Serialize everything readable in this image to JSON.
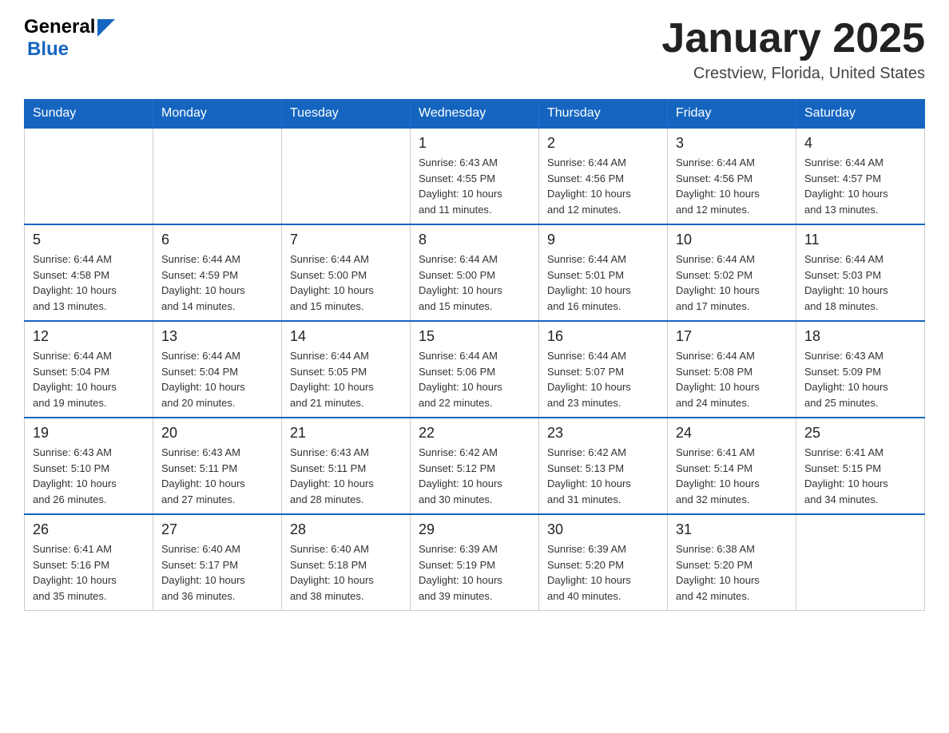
{
  "header": {
    "logo_general": "General",
    "logo_blue": "Blue",
    "month_title": "January 2025",
    "location": "Crestview, Florida, United States"
  },
  "days_of_week": [
    "Sunday",
    "Monday",
    "Tuesday",
    "Wednesday",
    "Thursday",
    "Friday",
    "Saturday"
  ],
  "weeks": [
    [
      {
        "day": "",
        "info": ""
      },
      {
        "day": "",
        "info": ""
      },
      {
        "day": "",
        "info": ""
      },
      {
        "day": "1",
        "info": "Sunrise: 6:43 AM\nSunset: 4:55 PM\nDaylight: 10 hours\nand 11 minutes."
      },
      {
        "day": "2",
        "info": "Sunrise: 6:44 AM\nSunset: 4:56 PM\nDaylight: 10 hours\nand 12 minutes."
      },
      {
        "day": "3",
        "info": "Sunrise: 6:44 AM\nSunset: 4:56 PM\nDaylight: 10 hours\nand 12 minutes."
      },
      {
        "day": "4",
        "info": "Sunrise: 6:44 AM\nSunset: 4:57 PM\nDaylight: 10 hours\nand 13 minutes."
      }
    ],
    [
      {
        "day": "5",
        "info": "Sunrise: 6:44 AM\nSunset: 4:58 PM\nDaylight: 10 hours\nand 13 minutes."
      },
      {
        "day": "6",
        "info": "Sunrise: 6:44 AM\nSunset: 4:59 PM\nDaylight: 10 hours\nand 14 minutes."
      },
      {
        "day": "7",
        "info": "Sunrise: 6:44 AM\nSunset: 5:00 PM\nDaylight: 10 hours\nand 15 minutes."
      },
      {
        "day": "8",
        "info": "Sunrise: 6:44 AM\nSunset: 5:00 PM\nDaylight: 10 hours\nand 15 minutes."
      },
      {
        "day": "9",
        "info": "Sunrise: 6:44 AM\nSunset: 5:01 PM\nDaylight: 10 hours\nand 16 minutes."
      },
      {
        "day": "10",
        "info": "Sunrise: 6:44 AM\nSunset: 5:02 PM\nDaylight: 10 hours\nand 17 minutes."
      },
      {
        "day": "11",
        "info": "Sunrise: 6:44 AM\nSunset: 5:03 PM\nDaylight: 10 hours\nand 18 minutes."
      }
    ],
    [
      {
        "day": "12",
        "info": "Sunrise: 6:44 AM\nSunset: 5:04 PM\nDaylight: 10 hours\nand 19 minutes."
      },
      {
        "day": "13",
        "info": "Sunrise: 6:44 AM\nSunset: 5:04 PM\nDaylight: 10 hours\nand 20 minutes."
      },
      {
        "day": "14",
        "info": "Sunrise: 6:44 AM\nSunset: 5:05 PM\nDaylight: 10 hours\nand 21 minutes."
      },
      {
        "day": "15",
        "info": "Sunrise: 6:44 AM\nSunset: 5:06 PM\nDaylight: 10 hours\nand 22 minutes."
      },
      {
        "day": "16",
        "info": "Sunrise: 6:44 AM\nSunset: 5:07 PM\nDaylight: 10 hours\nand 23 minutes."
      },
      {
        "day": "17",
        "info": "Sunrise: 6:44 AM\nSunset: 5:08 PM\nDaylight: 10 hours\nand 24 minutes."
      },
      {
        "day": "18",
        "info": "Sunrise: 6:43 AM\nSunset: 5:09 PM\nDaylight: 10 hours\nand 25 minutes."
      }
    ],
    [
      {
        "day": "19",
        "info": "Sunrise: 6:43 AM\nSunset: 5:10 PM\nDaylight: 10 hours\nand 26 minutes."
      },
      {
        "day": "20",
        "info": "Sunrise: 6:43 AM\nSunset: 5:11 PM\nDaylight: 10 hours\nand 27 minutes."
      },
      {
        "day": "21",
        "info": "Sunrise: 6:43 AM\nSunset: 5:11 PM\nDaylight: 10 hours\nand 28 minutes."
      },
      {
        "day": "22",
        "info": "Sunrise: 6:42 AM\nSunset: 5:12 PM\nDaylight: 10 hours\nand 30 minutes."
      },
      {
        "day": "23",
        "info": "Sunrise: 6:42 AM\nSunset: 5:13 PM\nDaylight: 10 hours\nand 31 minutes."
      },
      {
        "day": "24",
        "info": "Sunrise: 6:41 AM\nSunset: 5:14 PM\nDaylight: 10 hours\nand 32 minutes."
      },
      {
        "day": "25",
        "info": "Sunrise: 6:41 AM\nSunset: 5:15 PM\nDaylight: 10 hours\nand 34 minutes."
      }
    ],
    [
      {
        "day": "26",
        "info": "Sunrise: 6:41 AM\nSunset: 5:16 PM\nDaylight: 10 hours\nand 35 minutes."
      },
      {
        "day": "27",
        "info": "Sunrise: 6:40 AM\nSunset: 5:17 PM\nDaylight: 10 hours\nand 36 minutes."
      },
      {
        "day": "28",
        "info": "Sunrise: 6:40 AM\nSunset: 5:18 PM\nDaylight: 10 hours\nand 38 minutes."
      },
      {
        "day": "29",
        "info": "Sunrise: 6:39 AM\nSunset: 5:19 PM\nDaylight: 10 hours\nand 39 minutes."
      },
      {
        "day": "30",
        "info": "Sunrise: 6:39 AM\nSunset: 5:20 PM\nDaylight: 10 hours\nand 40 minutes."
      },
      {
        "day": "31",
        "info": "Sunrise: 6:38 AM\nSunset: 5:20 PM\nDaylight: 10 hours\nand 42 minutes."
      },
      {
        "day": "",
        "info": ""
      }
    ]
  ]
}
